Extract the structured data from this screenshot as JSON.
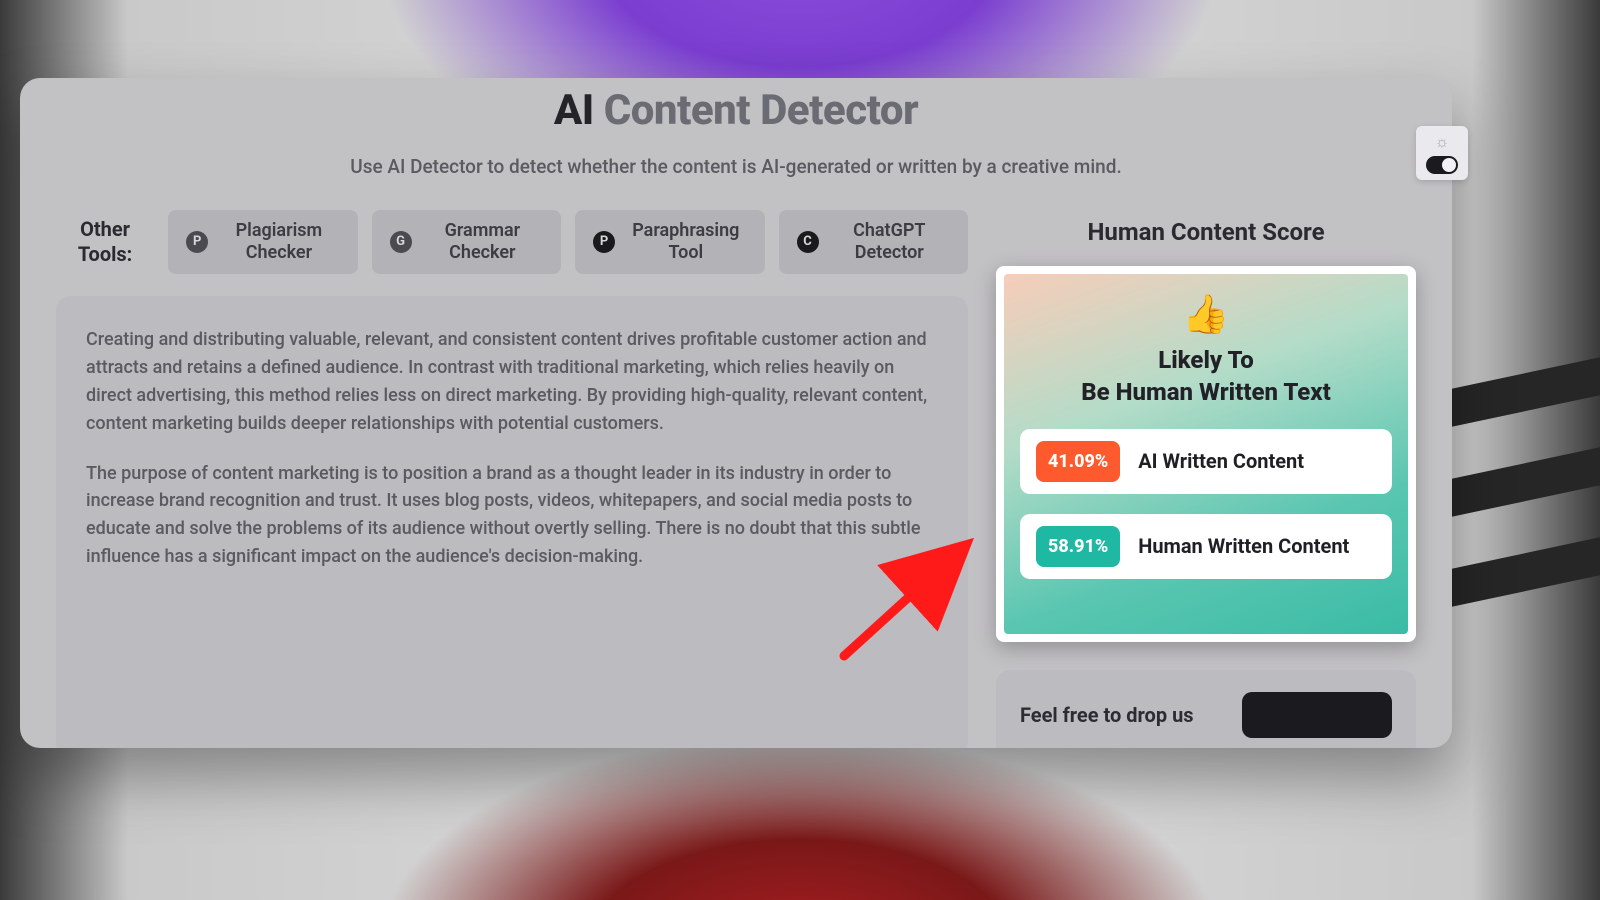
{
  "title_ai": "AI",
  "title_rest": " Content Detector",
  "subtitle": "Use AI Detector to detect whether the content is AI-generated or written by a creative mind.",
  "tools_label": "Other Tools:",
  "tools": [
    {
      "icon": "P",
      "label": "Plagiarism Checker",
      "dark": false
    },
    {
      "icon": "G",
      "label": "Grammar Checker",
      "dark": false
    },
    {
      "icon": "P",
      "label": "Paraphrasing Tool",
      "dark": true
    },
    {
      "icon": "C",
      "label": "ChatGPT Detector",
      "dark": true
    }
  ],
  "content": {
    "p1": "Creating and distributing valuable, relevant, and consistent content drives profitable customer action and attracts and retains a defined audience. In contrast with traditional marketing, which relies heavily on direct advertising, this method relies less on direct marketing. By providing high-quality, relevant content, content marketing builds deeper relationships with potential customers.",
    "p2": "The purpose of content marketing is to position a brand as a thought leader in its industry in order to increase brand recognition and trust. It uses blog posts, videos, whitepapers, and social media posts to educate and solve the problems of its audience without overtly selling. There is no doubt that this subtle influence has a significant impact on the audience's decision-making."
  },
  "score": {
    "heading": "Human Content Score",
    "thumb": "👍",
    "verdict_line1": "Likely To",
    "verdict_line2": "Be Human Written Text",
    "ai_pct": "41.09%",
    "ai_label": "AI Written Content",
    "human_pct": "58.91%",
    "human_label": "Human Written Content"
  },
  "feedback_text": "Feel free to drop us"
}
